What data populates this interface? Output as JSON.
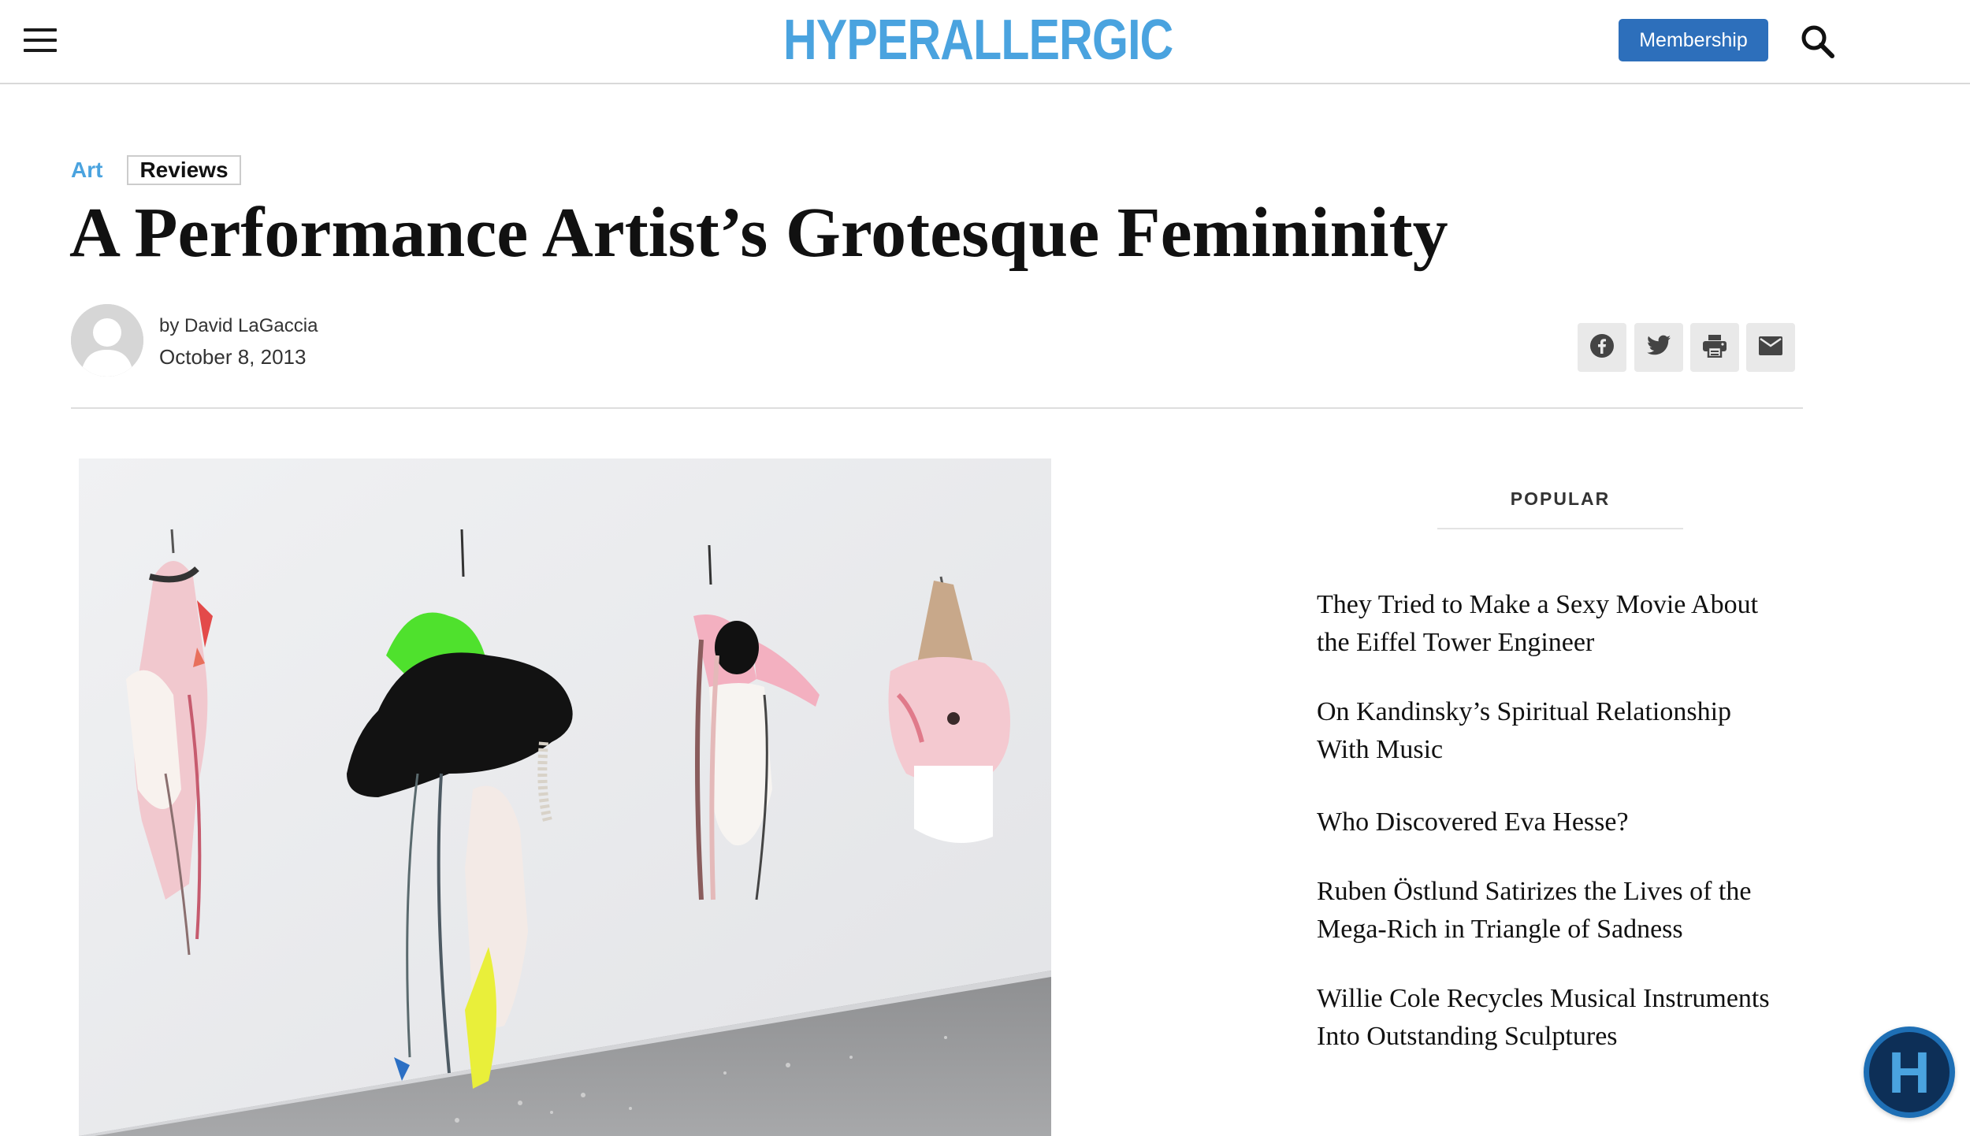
{
  "header": {
    "logo": "HYPERALLERGIC",
    "membership_label": "Membership",
    "menu_icon": "hamburger-menu-icon",
    "search_icon": "search-icon"
  },
  "article": {
    "category_primary": "Art",
    "category_secondary": "Reviews",
    "title": "A Performance Artist’s Grotesque Femininity",
    "by_prefix": "by",
    "author": "David LaGaccia",
    "date": "October 8, 2013",
    "share_icons": [
      "facebook-icon",
      "twitter-icon",
      "print-icon",
      "email-icon"
    ]
  },
  "sidebar": {
    "popular_label": "POPULAR",
    "items": [
      {
        "line1": "They Tried to Make a Sexy Movie About",
        "line2": "the Eiffel Tower Engineer"
      },
      {
        "line1": "On Kandinsky’s Spiritual Relationship",
        "line2": "With Music"
      },
      {
        "line1": "Who Discovered Eva Hesse?",
        "line2": ""
      },
      {
        "line1": "Ruben Östlund Satirizes the Lives of the",
        "line2": "Mega-Rich in Triangle of Sadness"
      },
      {
        "line1": "Willie Cole Recycles Musical Instruments",
        "line2": "Into Outstanding Sculptures"
      }
    ]
  },
  "fab": {
    "label": "H"
  },
  "colors": {
    "logo_blue": "#4aa3df",
    "membership_bg": "#2d6fbb",
    "fab_dark": "#0d2f57"
  }
}
